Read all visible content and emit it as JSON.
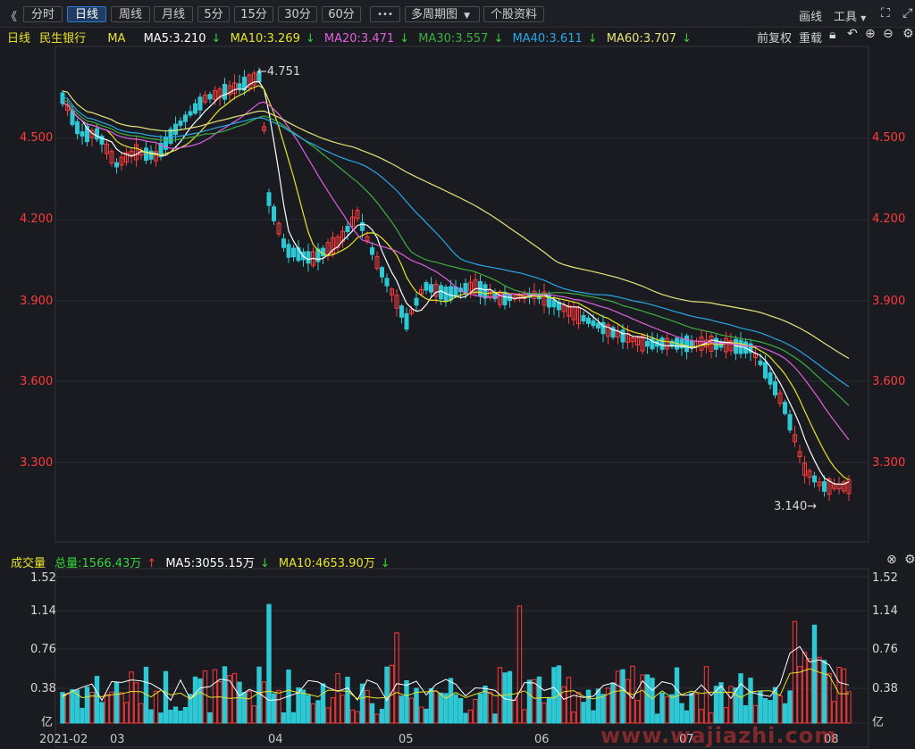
{
  "toolbar": {
    "back": "《",
    "tabs": [
      "分时",
      "日线",
      "周线",
      "月线",
      "5分",
      "15分",
      "30分",
      "60分"
    ],
    "more": "•••",
    "multi_period": "多周期图",
    "stock_info": "个股资料",
    "draw": "画线",
    "tools": "工具"
  },
  "legend": {
    "period": "日线",
    "stock": "民生银行",
    "ma": "MA",
    "ma5": "MA5:3.210",
    "ma10": "MA10:3.269",
    "ma20": "MA20:3.471",
    "ma30": "MA30:3.557",
    "ma40": "MA40:3.611",
    "ma60": "MA60:3.707",
    "adjust": "前复权",
    "reset": "重载"
  },
  "price_axis": [
    "4.500",
    "4.200",
    "3.900",
    "3.600",
    "3.300"
  ],
  "annotations": {
    "high": "4.751",
    "low": "3.140"
  },
  "volume_legend": {
    "title": "成交量",
    "total": "总量:1566.43万",
    "ma5": "MA5:3055.15万",
    "ma10": "MA10:4653.90万"
  },
  "volume_axis": [
    "1.52",
    "1.14",
    "0.76",
    "0.38",
    "亿"
  ],
  "dates": [
    "2021-02",
    "03",
    "04",
    "05",
    "06",
    "07",
    "08"
  ],
  "colors": {
    "up": "#ff3b3b",
    "down": "#2ec8d4",
    "ma5": "#ffffff",
    "ma10": "#e8e32a",
    "ma20": "#e05fe0",
    "ma30": "#3fae3f",
    "ma40": "#2aa6e8",
    "ma60": "#e8e37a"
  },
  "watermark": "www.wajiazhi.com"
}
